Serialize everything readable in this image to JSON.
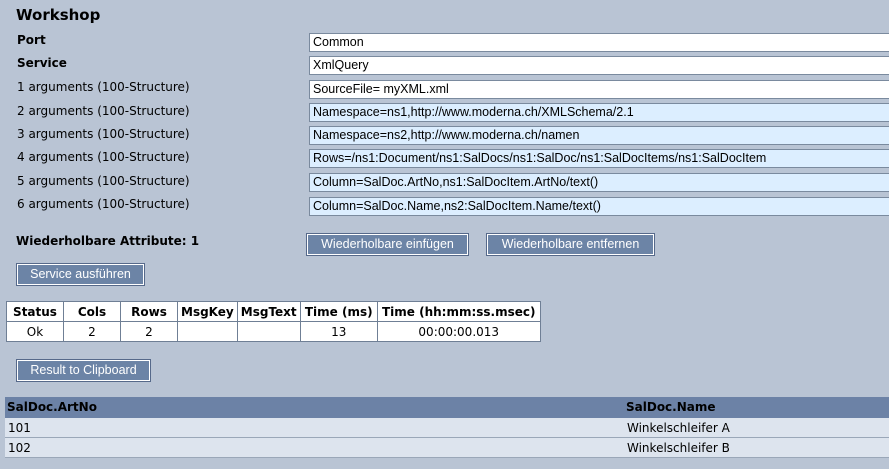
{
  "title": "Workshop",
  "form": {
    "port_label": "Port",
    "port_value": "Common",
    "service_label": "Service",
    "service_value": "XmlQuery",
    "args": [
      {
        "label": "1 arguments (100-Structure)",
        "value": "SourceFile= myXML.xml"
      },
      {
        "label": "2 arguments (100-Structure)",
        "value": "Namespace=ns1,http://www.moderna.ch/XMLSchema/2.1"
      },
      {
        "label": "3 arguments (100-Structure)",
        "value": "Namespace=ns2,http://www.moderna.ch/namen"
      },
      {
        "label": "4 arguments (100-Structure)",
        "value": "Rows=/ns1:Document/ns1:SalDocs/ns1:SalDoc/ns1:SalDocItems/ns1:SalDocItem"
      },
      {
        "label": "5 arguments (100-Structure)",
        "value": "Column=SalDoc.ArtNo,ns1:SalDocItem.ArtNo/text()"
      },
      {
        "label": "6 arguments (100-Structure)",
        "value": "Column=SalDoc.Name,ns2:SalDocItem.Name/text()"
      }
    ],
    "repeatable_label": "Wiederholbare Attribute: 1",
    "insert_button": "Wiederholbare einfügen",
    "remove_button": "Wiederholbare entfernen",
    "execute_button": "Service ausführen"
  },
  "status_table": {
    "headers": [
      "Status",
      "Cols",
      "Rows",
      "MsgKey",
      "MsgText",
      "Time (ms)",
      "Time (hh:mm:ss.msec)"
    ],
    "row": [
      "Ok",
      "2",
      "2",
      "",
      "",
      "13",
      "00:00:00.013"
    ]
  },
  "clipboard_button": "Result to Clipboard",
  "result": {
    "headers": [
      "SalDoc.ArtNo",
      "SalDoc.Name"
    ],
    "rows": [
      [
        "101",
        "Winkelschleifer A"
      ],
      [
        "102",
        "Winkelschleifer B"
      ]
    ]
  },
  "colors": {
    "background": "#b9c4d4",
    "button": "#6c84a6",
    "field_highlight": "#dceeff",
    "result_header": "#6c82a6"
  }
}
